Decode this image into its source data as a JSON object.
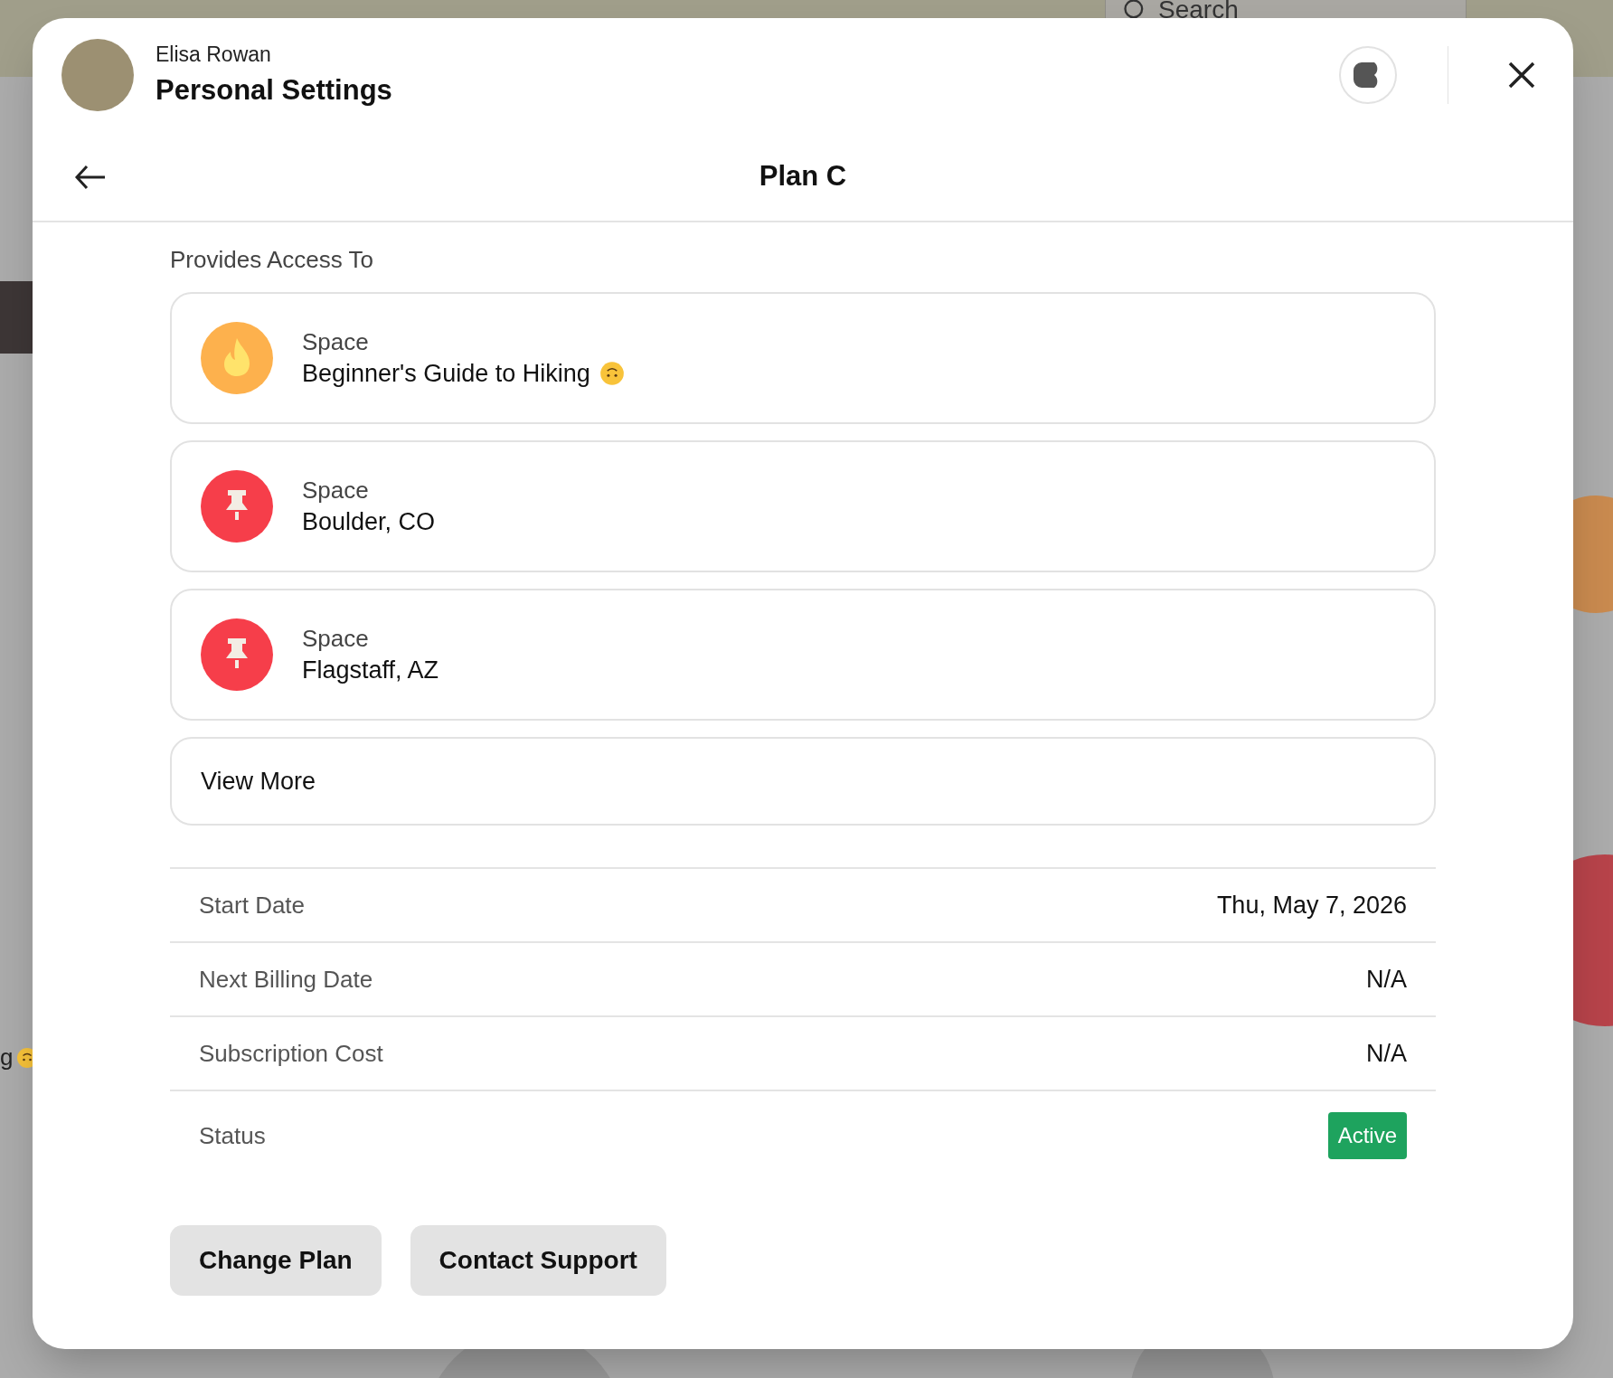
{
  "background": {
    "search": {
      "placeholder": "Search"
    },
    "fragment": "g",
    "fragment_emoji": true
  },
  "header": {
    "user_name": "Elisa Rowan",
    "title": "Personal Settings"
  },
  "page": {
    "title": "Plan C"
  },
  "access": {
    "heading": "Provides Access To",
    "items": [
      {
        "kind": "fire",
        "label": "Space",
        "name": "Beginner's Guide to Hiking",
        "emoji": true
      },
      {
        "kind": "pin",
        "label": "Space",
        "name": "Boulder, CO",
        "emoji": false
      },
      {
        "kind": "pin",
        "label": "Space",
        "name": "Flagstaff, AZ",
        "emoji": false
      }
    ],
    "view_more": "View More"
  },
  "details": [
    {
      "kind": "text",
      "label": "Start Date",
      "value": "Thu, May 7, 2026"
    },
    {
      "kind": "text",
      "label": "Next Billing Date",
      "value": "N/A"
    },
    {
      "kind": "text",
      "label": "Subscription Cost",
      "value": "N/A"
    },
    {
      "kind": "badge",
      "label": "Status",
      "value": "Active"
    }
  ],
  "buttons": [
    "Change Plan",
    "Contact Support"
  ]
}
